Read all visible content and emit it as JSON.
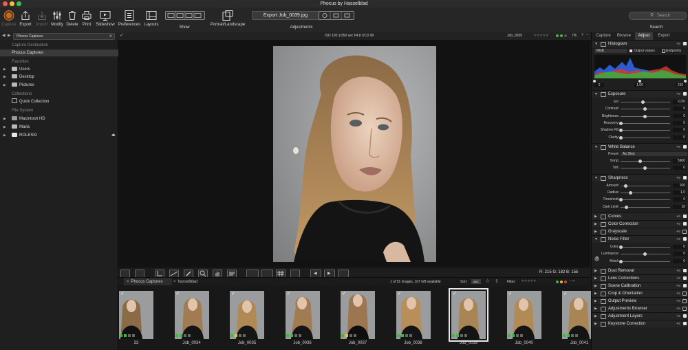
{
  "window": {
    "title": "Phocus by Hasselblad"
  },
  "toolbar": {
    "capture": "Capture",
    "export": "Export",
    "import": "Import",
    "modify": "Modify",
    "delete": "Delete",
    "print": "Print",
    "slideshow": "Slideshow",
    "preferences": "Preferences",
    "layouts": "Layouts",
    "show": "Show",
    "portrait_landscape": "Portrait/Landscape",
    "adjustments": "Adjustments",
    "search": "Search",
    "search_placeholder": "Search",
    "adjustment_file": "Export Job_0039.jpg"
  },
  "subbar": {
    "source": "Phocus Captures",
    "exif": "ISO 100   1/350 sec   f/4.8   XCD 90",
    "file": "Job_0039",
    "zoom": "7%"
  },
  "left_panel": {
    "capture_destination": "Capture Destination",
    "phocus_captures": "Phocus Captures",
    "favorites": "Favorites",
    "fav_items": [
      "Users",
      "Desktop",
      "Pictures"
    ],
    "collections": "Collections",
    "quick_collection": "Quick Collection",
    "file_system": "File System",
    "fs_items": [
      "Macintosh HD",
      "Maria",
      "ROLESKI"
    ]
  },
  "viewer": {
    "rgb_readout": "R: 215  G: 182  B: 155"
  },
  "browser": {
    "tabs": [
      "Phocus Captures",
      "hasselblad"
    ],
    "count": "1 of 51 images, 107 GB available",
    "sort_label": "Sort:",
    "sort_value": "ABC",
    "filter_label": "Filter:",
    "thumbnails": [
      "33",
      "Job_0034",
      "Job_0035",
      "Job_0036",
      "Job_0037",
      "Job_0038",
      "Job_0039",
      "Job_0040",
      "Job_0041"
    ],
    "selected_index": 6
  },
  "right_panel": {
    "tabs": [
      "Capture",
      "Browse",
      "Adjust",
      "Export"
    ],
    "active_tab": "Adjust",
    "histogram": {
      "title": "Histogram",
      "channel": "RGB",
      "output_values": "Output values",
      "endpoints": "Endpoints",
      "black": "0",
      "mid": "1,00",
      "white": "255"
    },
    "exposure": {
      "title": "Exposure",
      "rows": [
        {
          "label": "EV:",
          "value": "-0,50",
          "level": 0.45
        },
        {
          "label": "Contrast:",
          "value": "0",
          "level": 0.5
        },
        {
          "label": "Brightness:",
          "value": "0",
          "level": 0.5
        },
        {
          "label": "Recovery:",
          "value": "0",
          "level": 0.0
        },
        {
          "label": "Shadow Fill:",
          "value": "0",
          "level": 0.0
        },
        {
          "label": "Clarity:",
          "value": "0",
          "level": 0.0
        }
      ]
    },
    "white_balance": {
      "title": "White Balance",
      "preset_label": "Preset:",
      "preset_value": "As Shot",
      "rows": [
        {
          "label": "Temp:",
          "value": "5900",
          "level": 0.4
        },
        {
          "label": "Tint:",
          "value": "0",
          "level": 0.5
        }
      ]
    },
    "sharpness": {
      "title": "Sharpness",
      "rows": [
        {
          "label": "Amount:",
          "value": "100",
          "level": 0.1
        },
        {
          "label": "Radius:",
          "value": "1,0",
          "level": 0.2
        },
        {
          "label": "Threshold:",
          "value": "0",
          "level": 0.0
        },
        {
          "label": "Dark Limit:",
          "value": "10",
          "level": 0.12
        }
      ]
    },
    "collapsed_1": [
      {
        "title": "Curves",
        "checked": true
      },
      {
        "title": "Color Correction",
        "checked": true
      },
      {
        "title": "Grayscale",
        "checked": false
      }
    ],
    "noise": {
      "title": "Noise Filter",
      "rows": [
        {
          "label": "Color:",
          "value": "0",
          "level": 0.0
        },
        {
          "label": "Luminance:",
          "value": "0",
          "level": 0.5
        },
        {
          "label": "Moiré:",
          "value": "0",
          "level": 0.0
        }
      ]
    },
    "collapsed_2": [
      {
        "title": "Dust Removal",
        "checked": true
      },
      {
        "title": "Lens Corrections",
        "checked": true
      },
      {
        "title": "Scene Calibration",
        "checked": true
      },
      {
        "title": "Crop & Orientation",
        "checked": false
      },
      {
        "title": "Output Preview",
        "checked": false
      },
      {
        "title": "Adjustments Browser",
        "checked": false
      },
      {
        "title": "Adjustment Layers",
        "checked": true
      },
      {
        "title": "Keystone Correction",
        "checked": true
      }
    ]
  }
}
